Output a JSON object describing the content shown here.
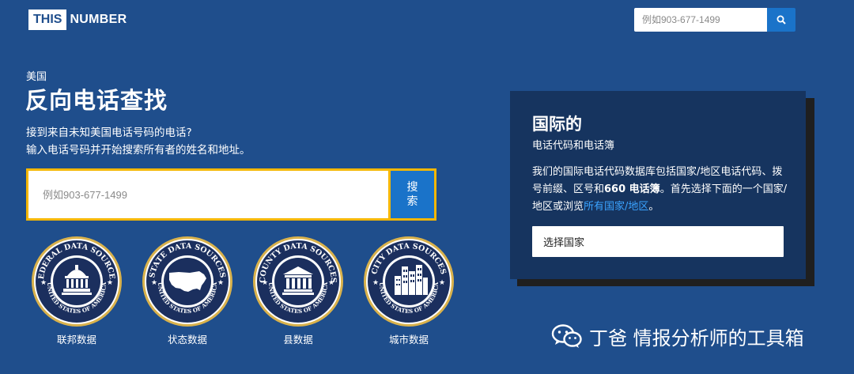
{
  "header": {
    "logo_box": "THIS",
    "logo_text": "NUMBER",
    "search_placeholder": "例如903-677-1499",
    "search_icon": "search-icon"
  },
  "hero": {
    "country": "美国",
    "title": "反向电话查找",
    "desc_line1": "接到来自未知美国电话号码的电话?",
    "desc_line2": "输入电话号码并开始搜索所有者的姓名和地址。",
    "search_placeholder": "例如903-677-1499",
    "search_button_line1": "搜",
    "search_button_line2": "索"
  },
  "seals": [
    {
      "top": "FEDERAL DATA SOURCES",
      "bottom": "UNITED STATES OF AMERICA",
      "icon": "capitol-icon",
      "label": "联邦数据"
    },
    {
      "top": "STATE DATA SOURCES",
      "bottom": "UNITED STATES OF AMERICA",
      "icon": "us-map-icon",
      "label": "状态数据"
    },
    {
      "top": "COUNTY DATA SOURCES",
      "bottom": "UNITED STATES OF AMERICA",
      "icon": "courthouse-icon",
      "label": "县数据"
    },
    {
      "top": "CITY DATA SOURCES",
      "bottom": "UNITED STATES OF AMERICA",
      "icon": "city-buildings-icon",
      "label": "城市数据"
    }
  ],
  "international": {
    "title": "国际的",
    "subtitle": "电话代码和电话簿",
    "body_part1": "我们的国际电话代码数据库包括国家/地区电话代码、拨号前缀、区号和",
    "body_bold": "660 电话簿",
    "body_part2": "。首先选择下面的一个国家/地区或浏览",
    "body_link": "所有国家/地区",
    "body_part3": "。",
    "select_value": "选择国家"
  },
  "watermark": {
    "text": "丁爸 情报分析师的工具箱",
    "icon": "wechat-icon"
  },
  "colors": {
    "background": "#1f4e8c",
    "panel": "#16345f",
    "accent_blue": "#1a73c9",
    "highlight_yellow": "#f5b700",
    "seal_navy": "#1b2f5e",
    "seal_gold": "#d9b24c",
    "link": "#3aa3ff"
  }
}
